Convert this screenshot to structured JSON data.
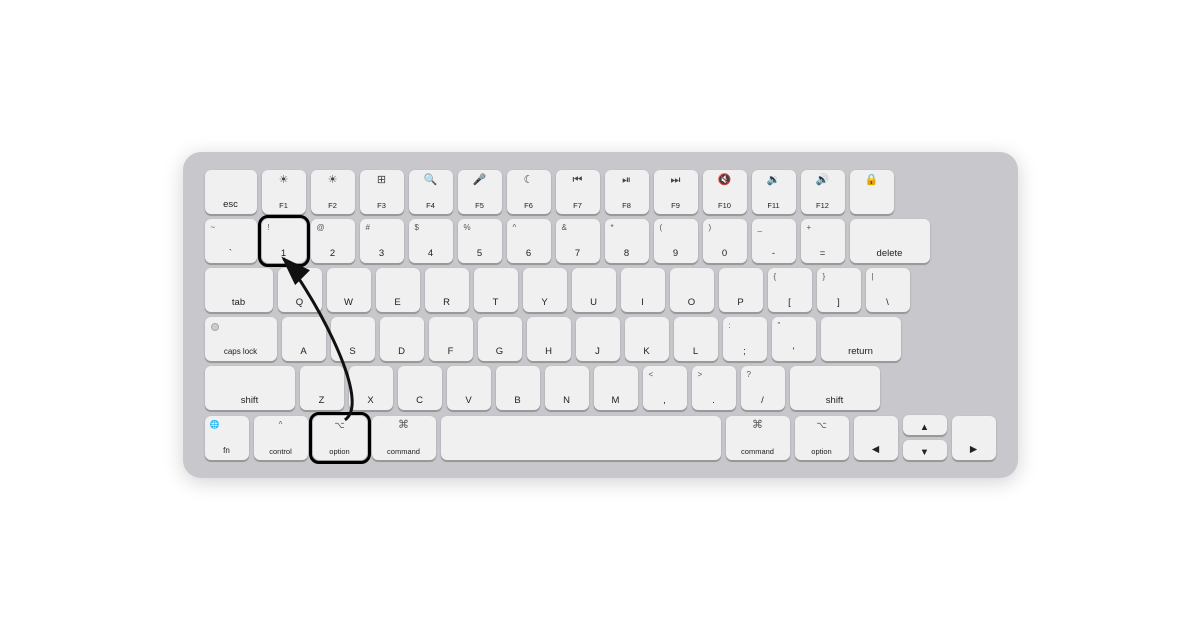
{
  "keyboard": {
    "rows": {
      "fn": [
        "esc",
        "F1",
        "F2",
        "F3",
        "F4",
        "F5",
        "F6",
        "F7",
        "F8",
        "F9",
        "F10",
        "F11",
        "F12",
        "lock"
      ],
      "numbers": [
        "~`",
        "!1",
        "@2",
        "#3",
        "$4",
        "%5",
        "^6",
        "&7",
        "*8",
        "(9",
        ")0",
        "-",
        "=",
        "delete"
      ],
      "qwerty": [
        "tab",
        "Q",
        "W",
        "E",
        "R",
        "T",
        "Y",
        "U",
        "I",
        "O",
        "P",
        "[{",
        "]}",
        "\\|"
      ],
      "asdf": [
        "caps lock",
        "A",
        "S",
        "D",
        "F",
        "G",
        "H",
        "J",
        "K",
        "L",
        ";:",
        "'\"",
        "return"
      ],
      "zxcv": [
        "shift",
        "Z",
        "X",
        "C",
        "V",
        "B",
        "N",
        "M",
        ",<",
        ".>",
        "/?",
        "shift"
      ],
      "bottom": [
        "fn",
        "control",
        "option",
        "command",
        "space",
        "command",
        "option",
        "◀",
        "▲▼",
        "▶"
      ]
    },
    "highlighted": [
      "key-1",
      "key-option-l"
    ],
    "arrows": [
      {
        "from": "key-option-l",
        "to": "key-1"
      }
    ]
  }
}
